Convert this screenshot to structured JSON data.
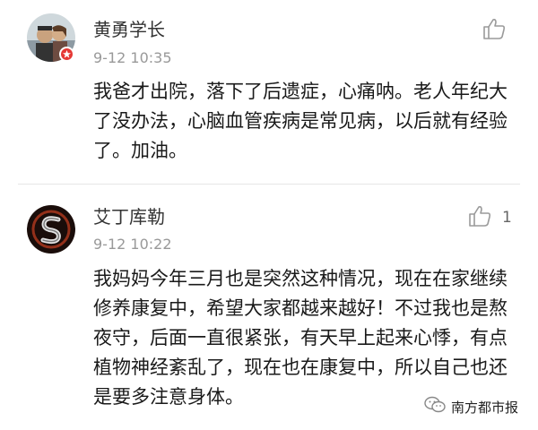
{
  "comments": [
    {
      "username": "黄勇学长",
      "timestamp": "9-12 10:35",
      "like_count": "",
      "text": "我爸才出院，落下了后遗症，心痛呐。老人年纪大了没办法，心脑血管疾病是常见病，以后就有经验了。加油。"
    },
    {
      "username": "艾丁库勒",
      "timestamp": "9-12 10:22",
      "like_count": "1",
      "text": "我妈妈今年三月也是突然这种情况，现在在家继续修养康复中，希望大家都越来越好！不过我也是熬夜守，后面一直很紧张，有天早上起来心悸，有点植物神经紊乱了，现在也在康复中，所以自己也还是要多注意身体。"
    }
  ],
  "watermark": {
    "text": "南方都市报",
    "icon": "wechat-icon"
  },
  "colors": {
    "badge": "#e53935",
    "timestamp": "#999999",
    "divider": "#e6e6e6"
  }
}
